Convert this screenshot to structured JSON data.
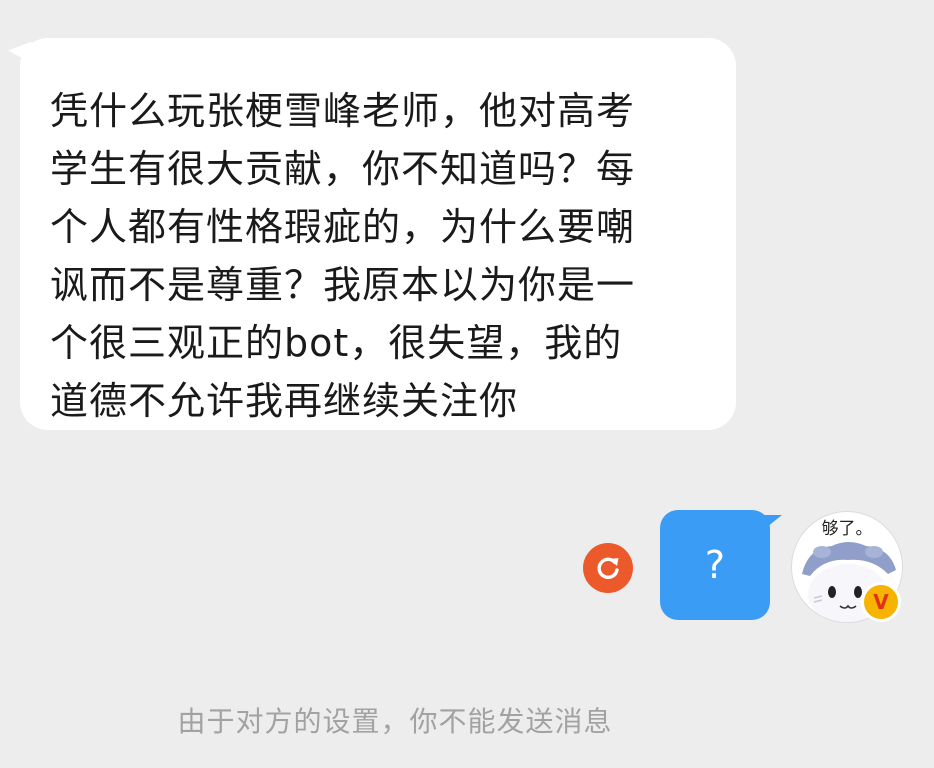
{
  "conversation": {
    "incoming_message": {
      "lines": [
        "凭什么玩张梗雪峰老师，他对高考",
        "学生有很大贡献，你不知道吗？每",
        "个人都有性格瑕疵的，为什么要嘲",
        "讽而不是尊重？我原本以为你是一",
        "个很三观正的bot，很失望，我的",
        "道德不允许我再继续关注你"
      ]
    },
    "outgoing_message": {
      "text": "?",
      "status_icon": "retry-icon",
      "status_color": "#ec5a2c"
    },
    "avatar": {
      "caption": "够了。",
      "badge_letter": "V",
      "badge_color": "#f6b400"
    },
    "system_notice": "由于对方的设置，你不能发送消息"
  },
  "colors": {
    "background": "#ededed",
    "incoming_bubble": "#ffffff",
    "outgoing_bubble": "#3a9cf5",
    "notice_text": "#a2a2a2"
  }
}
